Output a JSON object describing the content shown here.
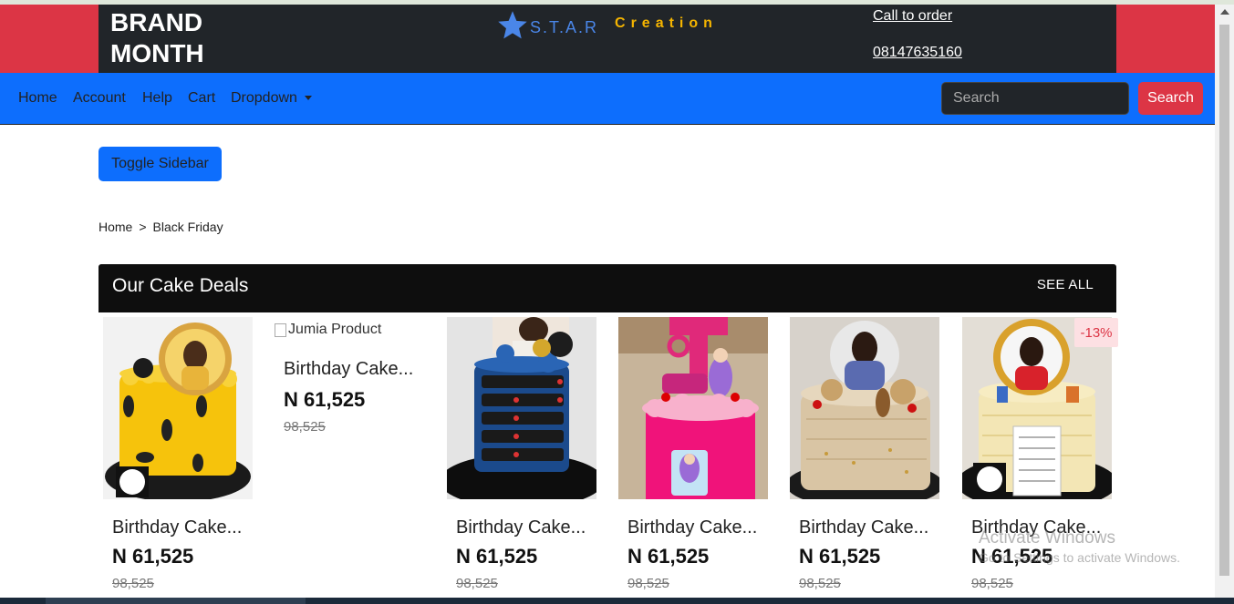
{
  "header": {
    "brand_line1": "BRAND",
    "brand_line2": "MONTH",
    "logo_text": "S.T.A.R",
    "logo_subtext": "Creation",
    "call_label": "Call to order",
    "phone": "08147635160",
    "colors": {
      "outer": "#dc3545",
      "inner": "#212529",
      "logo_blue": "#4a86e8",
      "logo_gold": "#f4b400"
    }
  },
  "nav": {
    "items": [
      "Home",
      "Account",
      "Help",
      "Cart",
      "Dropdown"
    ],
    "search_placeholder": "Search",
    "search_button": "Search",
    "color": "#0d6efd"
  },
  "sidebar_toggle": "Toggle Sidebar",
  "breadcrumb": {
    "home": "Home",
    "separator": ">",
    "current": "Black Friday"
  },
  "deals": {
    "title": "Our Cake Deals",
    "see_all": "SEE ALL",
    "products": [
      {
        "name": "Birthday Cake...",
        "price": "N 61,525",
        "old_price": "98,525",
        "image": "yellow-cake-photo"
      },
      {
        "name": "Birthday Cake...",
        "price": "N 61,525",
        "old_price": "98,525",
        "image_alt": "Jumia Product"
      },
      {
        "name": "Birthday Cake...",
        "price": "N 61,525",
        "old_price": "98,525",
        "image": "blue-cake-photo"
      },
      {
        "name": "Birthday Cake...",
        "price": "N 61,525",
        "old_price": "98,525",
        "image": "pink-cake-photo"
      },
      {
        "name": "Birthday Cake...",
        "price": "N 61,525",
        "old_price": "98,525",
        "image": "cream-cake-photo"
      },
      {
        "name": "Birthday Cake...",
        "price": "N 61,525",
        "old_price": "98,525",
        "image": "photo-cake",
        "discount": "-13%"
      }
    ]
  },
  "watermark": {
    "line1": "Activate Windows",
    "line2": "Go to Settings to activate Windows."
  }
}
